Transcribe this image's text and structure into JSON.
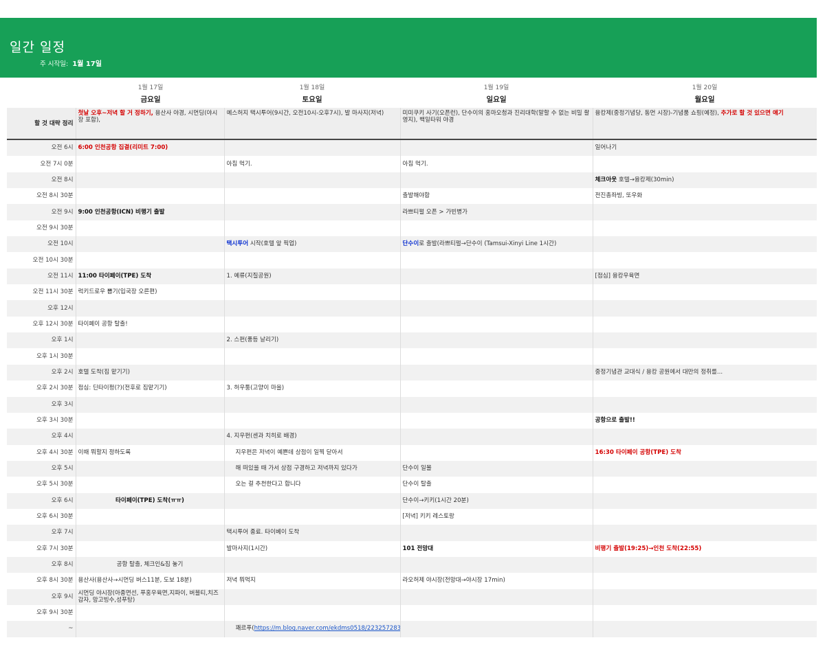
{
  "header": {
    "title": "일간 일정",
    "week_label": "주 시작일:",
    "week_value": "1월 17일"
  },
  "days": [
    {
      "date": "1월 17일",
      "name": "금요일"
    },
    {
      "date": "1월 18일",
      "name": "토요일"
    },
    {
      "date": "1월 19일",
      "name": "일요일"
    },
    {
      "date": "1월 20일",
      "name": "월요일"
    }
  ],
  "summary": {
    "label": "할 것 대략 정리",
    "fri_red": "첫날 오후~저녁 할 거 정하기,",
    "fri_rest": " 용산사 야경, 시먼딩(야시장 포함),",
    "sat": "예스허지 택시투어(9시간, 오전10시-오후7시), 발 마사지(저녁)",
    "sun": "미미쿠키 사기(오픈런), 단수이의 홍마오청과 진리대학(말할 수 없는 비밀 촬영지), 백일타워 야경",
    "mon_plain": "융캉제(중정기념당, 동먼 시장)-기념품 쇼핑(예정), ",
    "mon_red": "추가로 할 것 있으면 얘기"
  },
  "rows": [
    {
      "time": "오전 6시",
      "fri": "6:00 인천공항 집결(리미트 7:00)",
      "sat": "",
      "sun": "",
      "mon": "일어나기"
    },
    {
      "time": "오전 7시 0분",
      "fri": "",
      "sat": "아침 먹기.",
      "sun": "아침 먹기.",
      "mon": ""
    },
    {
      "time": "오전 8시",
      "fri": "",
      "sat": "",
      "sun": "",
      "mon_bold": "체크아웃",
      "mon": " 호텔→융캉제(30min)"
    },
    {
      "time": "오전 8시 30분",
      "fri": "",
      "sat": "",
      "sun": "출발해야함",
      "mon": "전진총좌빙, 또우화"
    },
    {
      "time": "오전 9시",
      "fri": "9:00 인천공항(ICN) 비행기 출발",
      "sat": "",
      "sun": "라쁘티펄 오픈 > 가빈병가",
      "mon": ""
    },
    {
      "time": "오전 9시 30분",
      "fri": "",
      "sat": "",
      "sun": "",
      "mon": ""
    },
    {
      "time": "오전 10시",
      "fri": "",
      "sat_blue": "택시투어",
      "sat": " 시작(호텔 앞 픽업)",
      "sun_blue": "단수이",
      "sun": "로 출발(라쁘티펄→단수이 (Tamsui-Xinyi Line 1시간)",
      "mon": ""
    },
    {
      "time": "오전 10시 30분",
      "fri": "",
      "sat": "",
      "sun": "",
      "mon": ""
    },
    {
      "time": "오전 11시",
      "fri": "11:00 타이페이(TPE) 도착",
      "sat": "1. 예류(지질공원)",
      "sun": "",
      "mon": "[점심] 융캉우육면"
    },
    {
      "time": "오전 11시 30분",
      "fri": "럭키드로우 뽑기(입국장 오른편)",
      "sat": "",
      "sun": "",
      "mon": ""
    },
    {
      "time": "오후 12시",
      "fri": "",
      "sat": "",
      "sun": "",
      "mon": ""
    },
    {
      "time": "오후 12시 30분",
      "fri": "타이페이 공항 탈출!",
      "sat": "",
      "sun": "",
      "mon": ""
    },
    {
      "time": "오후 1시",
      "fri": "",
      "sat": "2. 스펀(풍등 날리기)",
      "sun": "",
      "mon": ""
    },
    {
      "time": "오후 1시 30분",
      "fri": "",
      "sat": "",
      "sun": "",
      "mon": ""
    },
    {
      "time": "오후 2시",
      "fri": "호텔 도착(짐 맡기기)",
      "sat": "",
      "sun": "",
      "mon": "중정기념관 교대식 / 용캉 공원에서 대만의 정취를..."
    },
    {
      "time": "오후 2시 30분",
      "fri": "점심: 딘타이펑(?)(전후로 짐맡기기)",
      "sat": "3. 허우퉁(고양이 마을)",
      "sun": "",
      "mon": ""
    },
    {
      "time": "오후 3시",
      "fri": "",
      "sat": "",
      "sun": "",
      "mon": ""
    },
    {
      "time": "오후 3시 30분",
      "fri": "",
      "sat": "",
      "sun": "",
      "mon": "공항으로 출발!!"
    },
    {
      "time": "오후 4시",
      "fri": "",
      "sat": "4. 지우펀(센과 치히로 배경)",
      "sun": "",
      "mon": ""
    },
    {
      "time": "오후 4시 30분",
      "fri": "이때 뭐할지 정하도록",
      "sat": "지우펀은 저녁이 예쁜데 상점이 일찍 닫아서",
      "sun": "",
      "mon": "16:30 타이페이 공항(TPE) 도착"
    },
    {
      "time": "오후 5시",
      "fri": "",
      "sat": "해 떠있을 때 가서 상점 구경하고 저녁까지 있다가",
      "sun": "단수이 일몰",
      "mon": ""
    },
    {
      "time": "오후 5시 30분",
      "fri": "",
      "sat": "오는 걸 추천한다고 합니다",
      "sun": "단수이 탈출",
      "mon": ""
    },
    {
      "time": "오후 6시",
      "fri": "타이페이(TPE) 도착(ㅠㅠ)",
      "sat": "",
      "sun": "단수이→키키(1시간 20분)",
      "mon": ""
    },
    {
      "time": "오후 6시 30분",
      "fri": "",
      "sat": "",
      "sun": "[저녁] 키키 레스토랑",
      "mon": ""
    },
    {
      "time": "오후 7시",
      "fri": "",
      "sat": "택시투어 종료. 타이베이 도착",
      "sun": "",
      "mon": ""
    },
    {
      "time": "오후 7시 30분",
      "fri": "",
      "sat": "발마사지(1시간)",
      "sun": "101 전망대",
      "mon": "비행기 출발(19:25)→인천 도착(22:55)"
    },
    {
      "time": "오후 8시",
      "fri": "공항 탈출, 체크인&짐 놓기",
      "sat": "",
      "sun": "",
      "mon": ""
    },
    {
      "time": "오후 8시 30분",
      "fri": "용산사(용산사→시먼딩 버스11분, 도보 18분)",
      "sat": "저녁 뭐먹지",
      "sun": "라오허제 야시장(전망대→야시장 17min)",
      "mon": ""
    },
    {
      "time": "오후 9시",
      "fri": "시먼딩 야시장(아종면선, 푸홍우육면,지파이, 버블티,치즈감자, 망고빙수,성푸탕)",
      "sat": "",
      "sun": "",
      "mon": ""
    },
    {
      "time": "오후 9시 30분",
      "fri": "",
      "sat": "",
      "sun": "",
      "mon": ""
    },
    {
      "time": "~",
      "fri": "",
      "sat": "꽤르푸(",
      "sat_link": "https://m.blog.naver.com/ekdms0518/223257283328",
      "sat_tail": ")",
      "sun": "",
      "mon": ""
    }
  ]
}
